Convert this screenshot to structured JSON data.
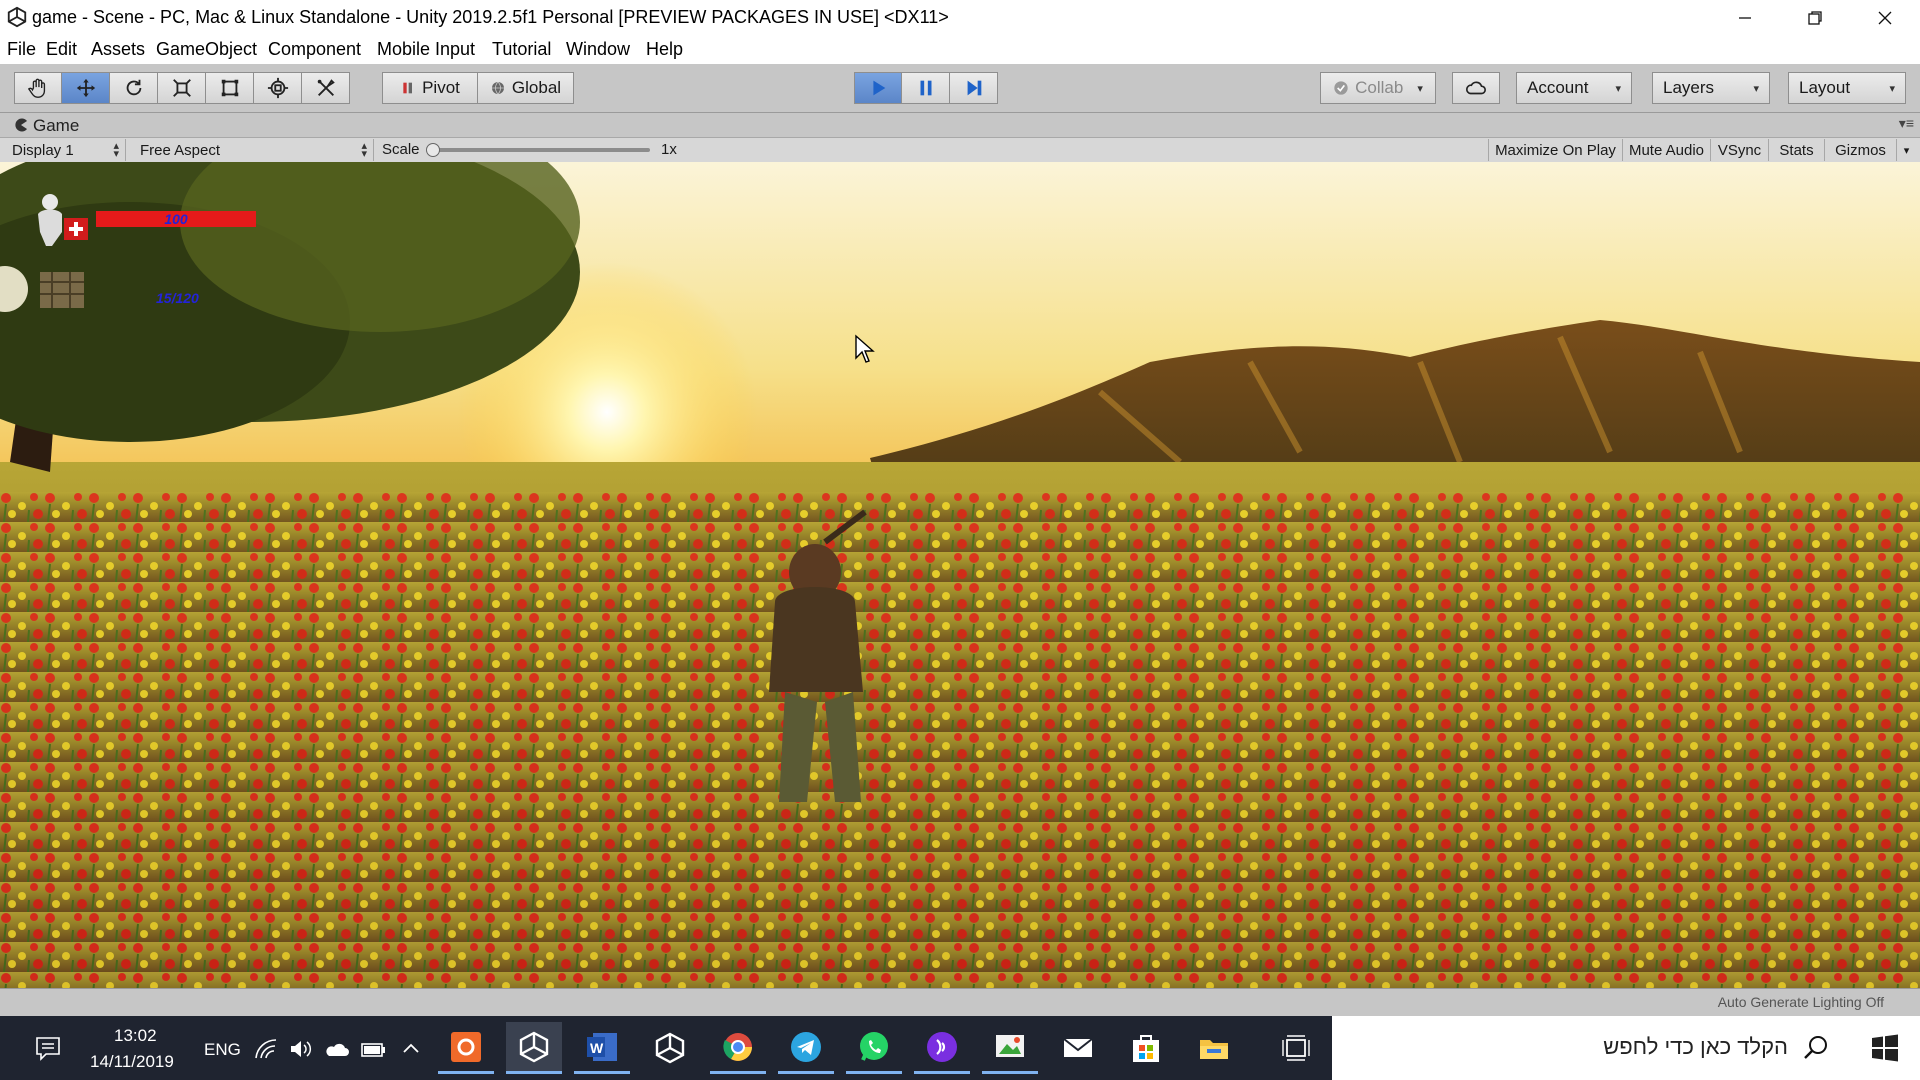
{
  "window": {
    "title": "game - Scene - PC, Mac & Linux Standalone - Unity 2019.2.5f1 Personal [PREVIEW PACKAGES IN USE] <DX11>"
  },
  "menu": [
    "File",
    "Edit",
    "Assets",
    "GameObject",
    "Component",
    "Mobile Input",
    "Tutorial",
    "Window",
    "Help"
  ],
  "toolbar": {
    "tools": [
      "hand-tool-icon",
      "move-tool-icon",
      "rotate-tool-icon",
      "scale-tool-icon",
      "rect-tool-icon",
      "transform-tool-icon",
      "custom-tool-icon"
    ],
    "pivot_label": "Pivot",
    "global_label": "Global",
    "collab_label": "Collab",
    "account_label": "Account",
    "layers_label": "Layers",
    "layout_label": "Layout",
    "play_active": true,
    "accent_color": "#2b6fd6"
  },
  "game_tab": {
    "label": "Game"
  },
  "game_bar": {
    "display": "Display 1",
    "aspect": "Free Aspect",
    "scale_label": "Scale",
    "scale_value": "1x",
    "scale_level": 0,
    "toggles": [
      "Maximize On Play",
      "Mute Audio",
      "VSync",
      "Stats",
      "Gizmos"
    ]
  },
  "hud": {
    "health_value": "100",
    "health_color": "#e51a1a",
    "ammo_value": "15/120"
  },
  "status": {
    "text": "Auto Generate Lighting Off"
  },
  "taskbar": {
    "time": "13:02",
    "date": "14/11/2019",
    "language": "ENG",
    "search_placeholder": "הקלד כאן כדי לחפש",
    "apps": [
      "snip-app-icon",
      "unity-icon",
      "word-icon",
      "unity-hub-icon",
      "chrome-icon",
      "telegram-icon",
      "whatsapp-icon",
      "podcast-icon",
      "paint-icon",
      "mail-icon",
      "store-icon",
      "explorer-icon",
      "task-view-icon"
    ]
  }
}
